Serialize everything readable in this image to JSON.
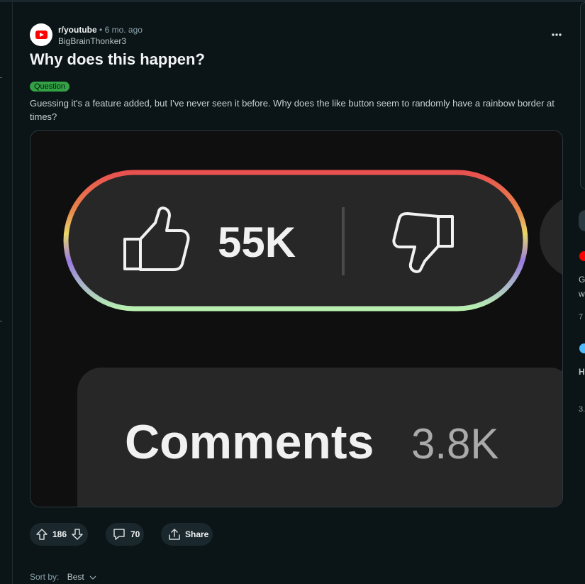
{
  "post": {
    "subreddit": "r/youtube",
    "separator": "•",
    "time": "6 mo. ago",
    "author": "BigBrainThonker3",
    "title": "Why does this happen?",
    "flair": "Question",
    "body": "Guessing it's a feature added, but I've never seen it before. Why does the like button seem to randomly have a rainbow border at times?",
    "more_icon": "more-horizontal-icon"
  },
  "media": {
    "like_count": "55K",
    "comments_label": "Comments",
    "comments_count": "3.8K"
  },
  "actions": {
    "votes": "186",
    "comments": "70",
    "share": "Share"
  },
  "sort": {
    "label": "Sort by:",
    "value": "Best"
  },
  "right_rail": {
    "line1": "G",
    "line2": "w",
    "line3": "7",
    "line4": "H",
    "line5": "3."
  },
  "colors": {
    "background": "#0b1416",
    "action_pill": "#1a282d",
    "flair": "#33a244",
    "youtube_red": "#ff0000"
  }
}
